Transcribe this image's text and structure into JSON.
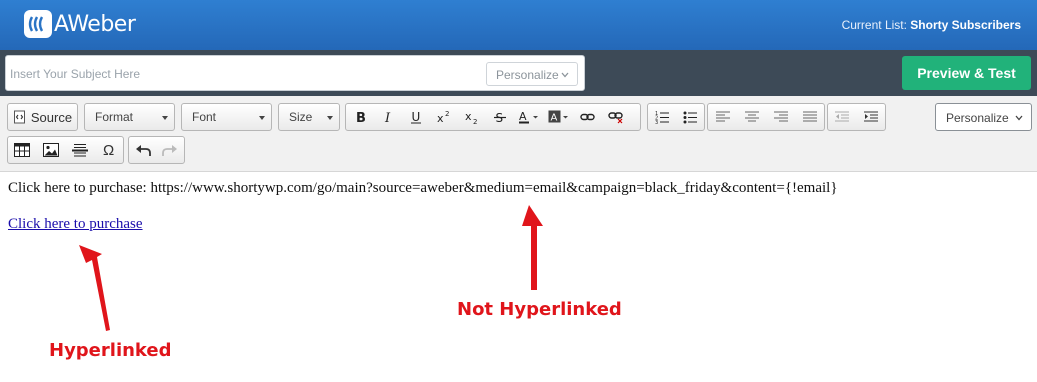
{
  "header": {
    "logo_text": "AWeber",
    "current_list_label": "Current List:",
    "current_list_value": "Shorty Subscribers"
  },
  "subject": {
    "placeholder": "Insert Your Subject Here",
    "value": "",
    "personalize_label": "Personalize"
  },
  "preview_button_label": "Preview & Test",
  "toolbar": {
    "source_label": "Source",
    "format_label": "Format",
    "font_label": "Font",
    "size_label": "Size",
    "omega_label": "Ω",
    "personalize_label": "Personalize"
  },
  "content": {
    "line1": "Click here to purchase: https://www.shortywp.com/go/main?source=aweber&medium=email&campaign=black_friday&content={!email}",
    "link_text": "Click here to purchase"
  },
  "annotations": {
    "hyperlinked": "Hyperlinked",
    "not_hyperlinked": "Not Hyperlinked",
    "color": "#e0151b"
  },
  "colors": {
    "header_blue": "#2a74c5",
    "subject_bar": "#3d4a57",
    "preview_green": "#21b27a",
    "link_blue": "#1a0dab"
  }
}
